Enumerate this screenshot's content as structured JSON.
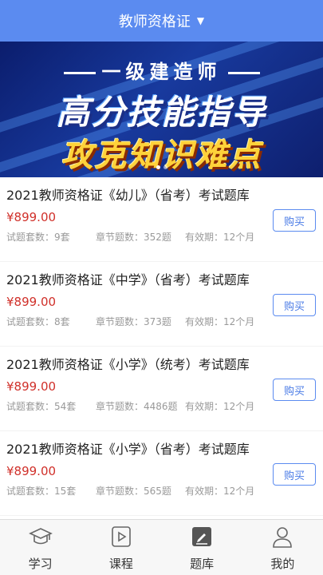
{
  "header": {
    "title": "教师资格证",
    "caret": "▼"
  },
  "banner": {
    "top_title": "一级建造师",
    "line1": "高分技能指导",
    "line2": "攻克知识难点"
  },
  "products": [
    {
      "title": "2021教师资格证《幼儿》（省考）考试题库",
      "price": "¥899.00",
      "sets": "试题套数：9套",
      "chapters": "章节题数：352题",
      "validity": "有效期：12个月",
      "buy": "购买"
    },
    {
      "title": "2021教师资格证《中学》（省考）考试题库",
      "price": "¥899.00",
      "sets": "试题套数：8套",
      "chapters": "章节题数：373题",
      "validity": "有效期：12个月",
      "buy": "购买"
    },
    {
      "title": "2021教师资格证《小学》（统考）考试题库",
      "price": "¥899.00",
      "sets": "试题套数：54套",
      "chapters": "章节题数：4486题",
      "validity": "有效期：12个月",
      "buy": "购买"
    },
    {
      "title": "2021教师资格证《小学》（省考）考试题库",
      "price": "¥899.00",
      "sets": "试题套数：15套",
      "chapters": "章节题数：565题",
      "validity": "有效期：12个月",
      "buy": "购买"
    }
  ],
  "tabs": [
    {
      "label": "学习",
      "icon": "graduation-cap-icon"
    },
    {
      "label": "课程",
      "icon": "play-icon"
    },
    {
      "label": "题库",
      "icon": "edit-icon",
      "active": true
    },
    {
      "label": "我的",
      "icon": "user-icon"
    }
  ],
  "colors": {
    "header": "#5b8bf0",
    "price": "#d0302a",
    "buy_border": "#5b8bf0"
  }
}
